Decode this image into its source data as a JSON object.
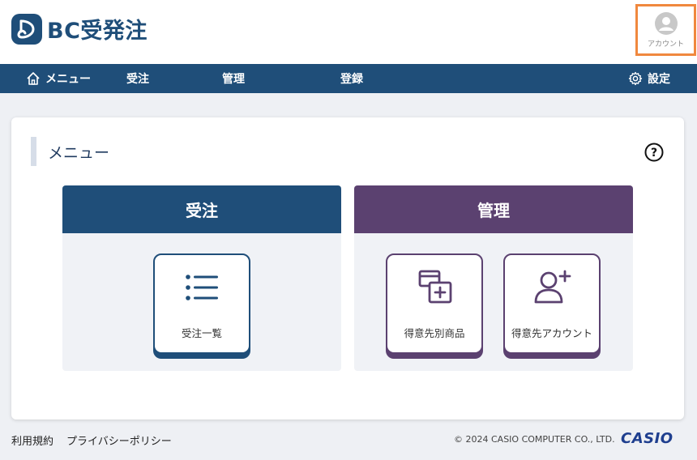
{
  "app": {
    "title": "BC受発注",
    "account_label": "アカウント"
  },
  "nav": {
    "menu": "メニュー",
    "order": "受注",
    "admin": "管理",
    "register": "登録",
    "settings": "設定"
  },
  "page": {
    "title": "メニュー",
    "help_glyph": "?"
  },
  "panels": {
    "order": {
      "title": "受注",
      "tiles": [
        {
          "label": "受注一覧",
          "icon": "list-icon"
        }
      ]
    },
    "admin": {
      "title": "管理",
      "tiles": [
        {
          "label": "得意先別商品",
          "icon": "documents-add-icon"
        },
        {
          "label": "得意先アカウント",
          "icon": "user-add-icon"
        }
      ]
    }
  },
  "footer": {
    "terms": "利用規約",
    "privacy": "プライバシーポリシー",
    "copyright": "© 2024 CASIO COMPUTER CO., LTD.",
    "brand": "CASIO"
  },
  "colors": {
    "primary": "#1f4e79",
    "admin": "#5b4170",
    "highlight": "#f0883e",
    "background": "#eef0f4"
  }
}
